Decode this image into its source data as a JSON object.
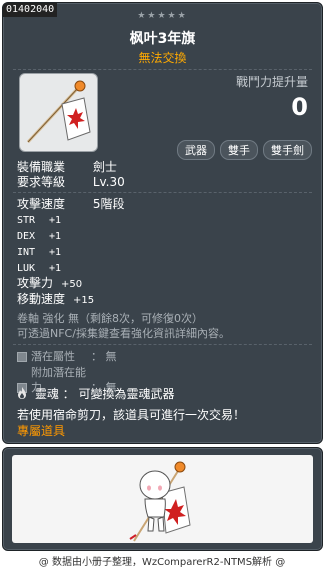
{
  "item": {
    "id": "01402040",
    "stars": "★★★★★",
    "name": "枫叶3年旗",
    "trade": "無法交換",
    "power_label": "戰鬥力提升量",
    "power_value": "0",
    "tags": [
      "武器",
      "雙手",
      "雙手劍"
    ]
  },
  "info": {
    "job_label": "裝備職業",
    "job_value": "劍士",
    "level_label": "要求等級",
    "level_value": "Lv.30",
    "speed_label": "攻擊速度",
    "speed_value": "5階段"
  },
  "stats": [
    {
      "k": "STR",
      "v": "+1"
    },
    {
      "k": "DEX",
      "v": "+1"
    },
    {
      "k": "INT",
      "v": "+1"
    },
    {
      "k": "LUK",
      "v": "+1"
    }
  ],
  "stats2": [
    {
      "k": "攻擊力",
      "v": "+50"
    },
    {
      "k": "移動速度",
      "v": "+15"
    }
  ],
  "scroll_line": "卷軸 強化 無（剩餘8次，可修復0次）",
  "scroll_hint": "可透過NFC/採集鍵查看強化資訊詳細內容。",
  "potential": [
    {
      "k": "潛在屬性",
      "v": "： 無"
    },
    {
      "k": "附加潛在能力",
      "v": "： 無"
    }
  ],
  "soul": {
    "label": "靈魂",
    "text": "：  可變換為靈魂武器"
  },
  "cut_text": "若使用宿命剪刀，該道具可進行一次交易！",
  "exclusive": "專屬道具",
  "footer": "@ 数据由小册子整理，WzComparerR2-NTMS解析 @",
  "colors": {
    "panel": "#3a434b",
    "orange": "#ffaa00",
    "exclusive": "#ff9900",
    "gray": "#a9b0b6"
  }
}
